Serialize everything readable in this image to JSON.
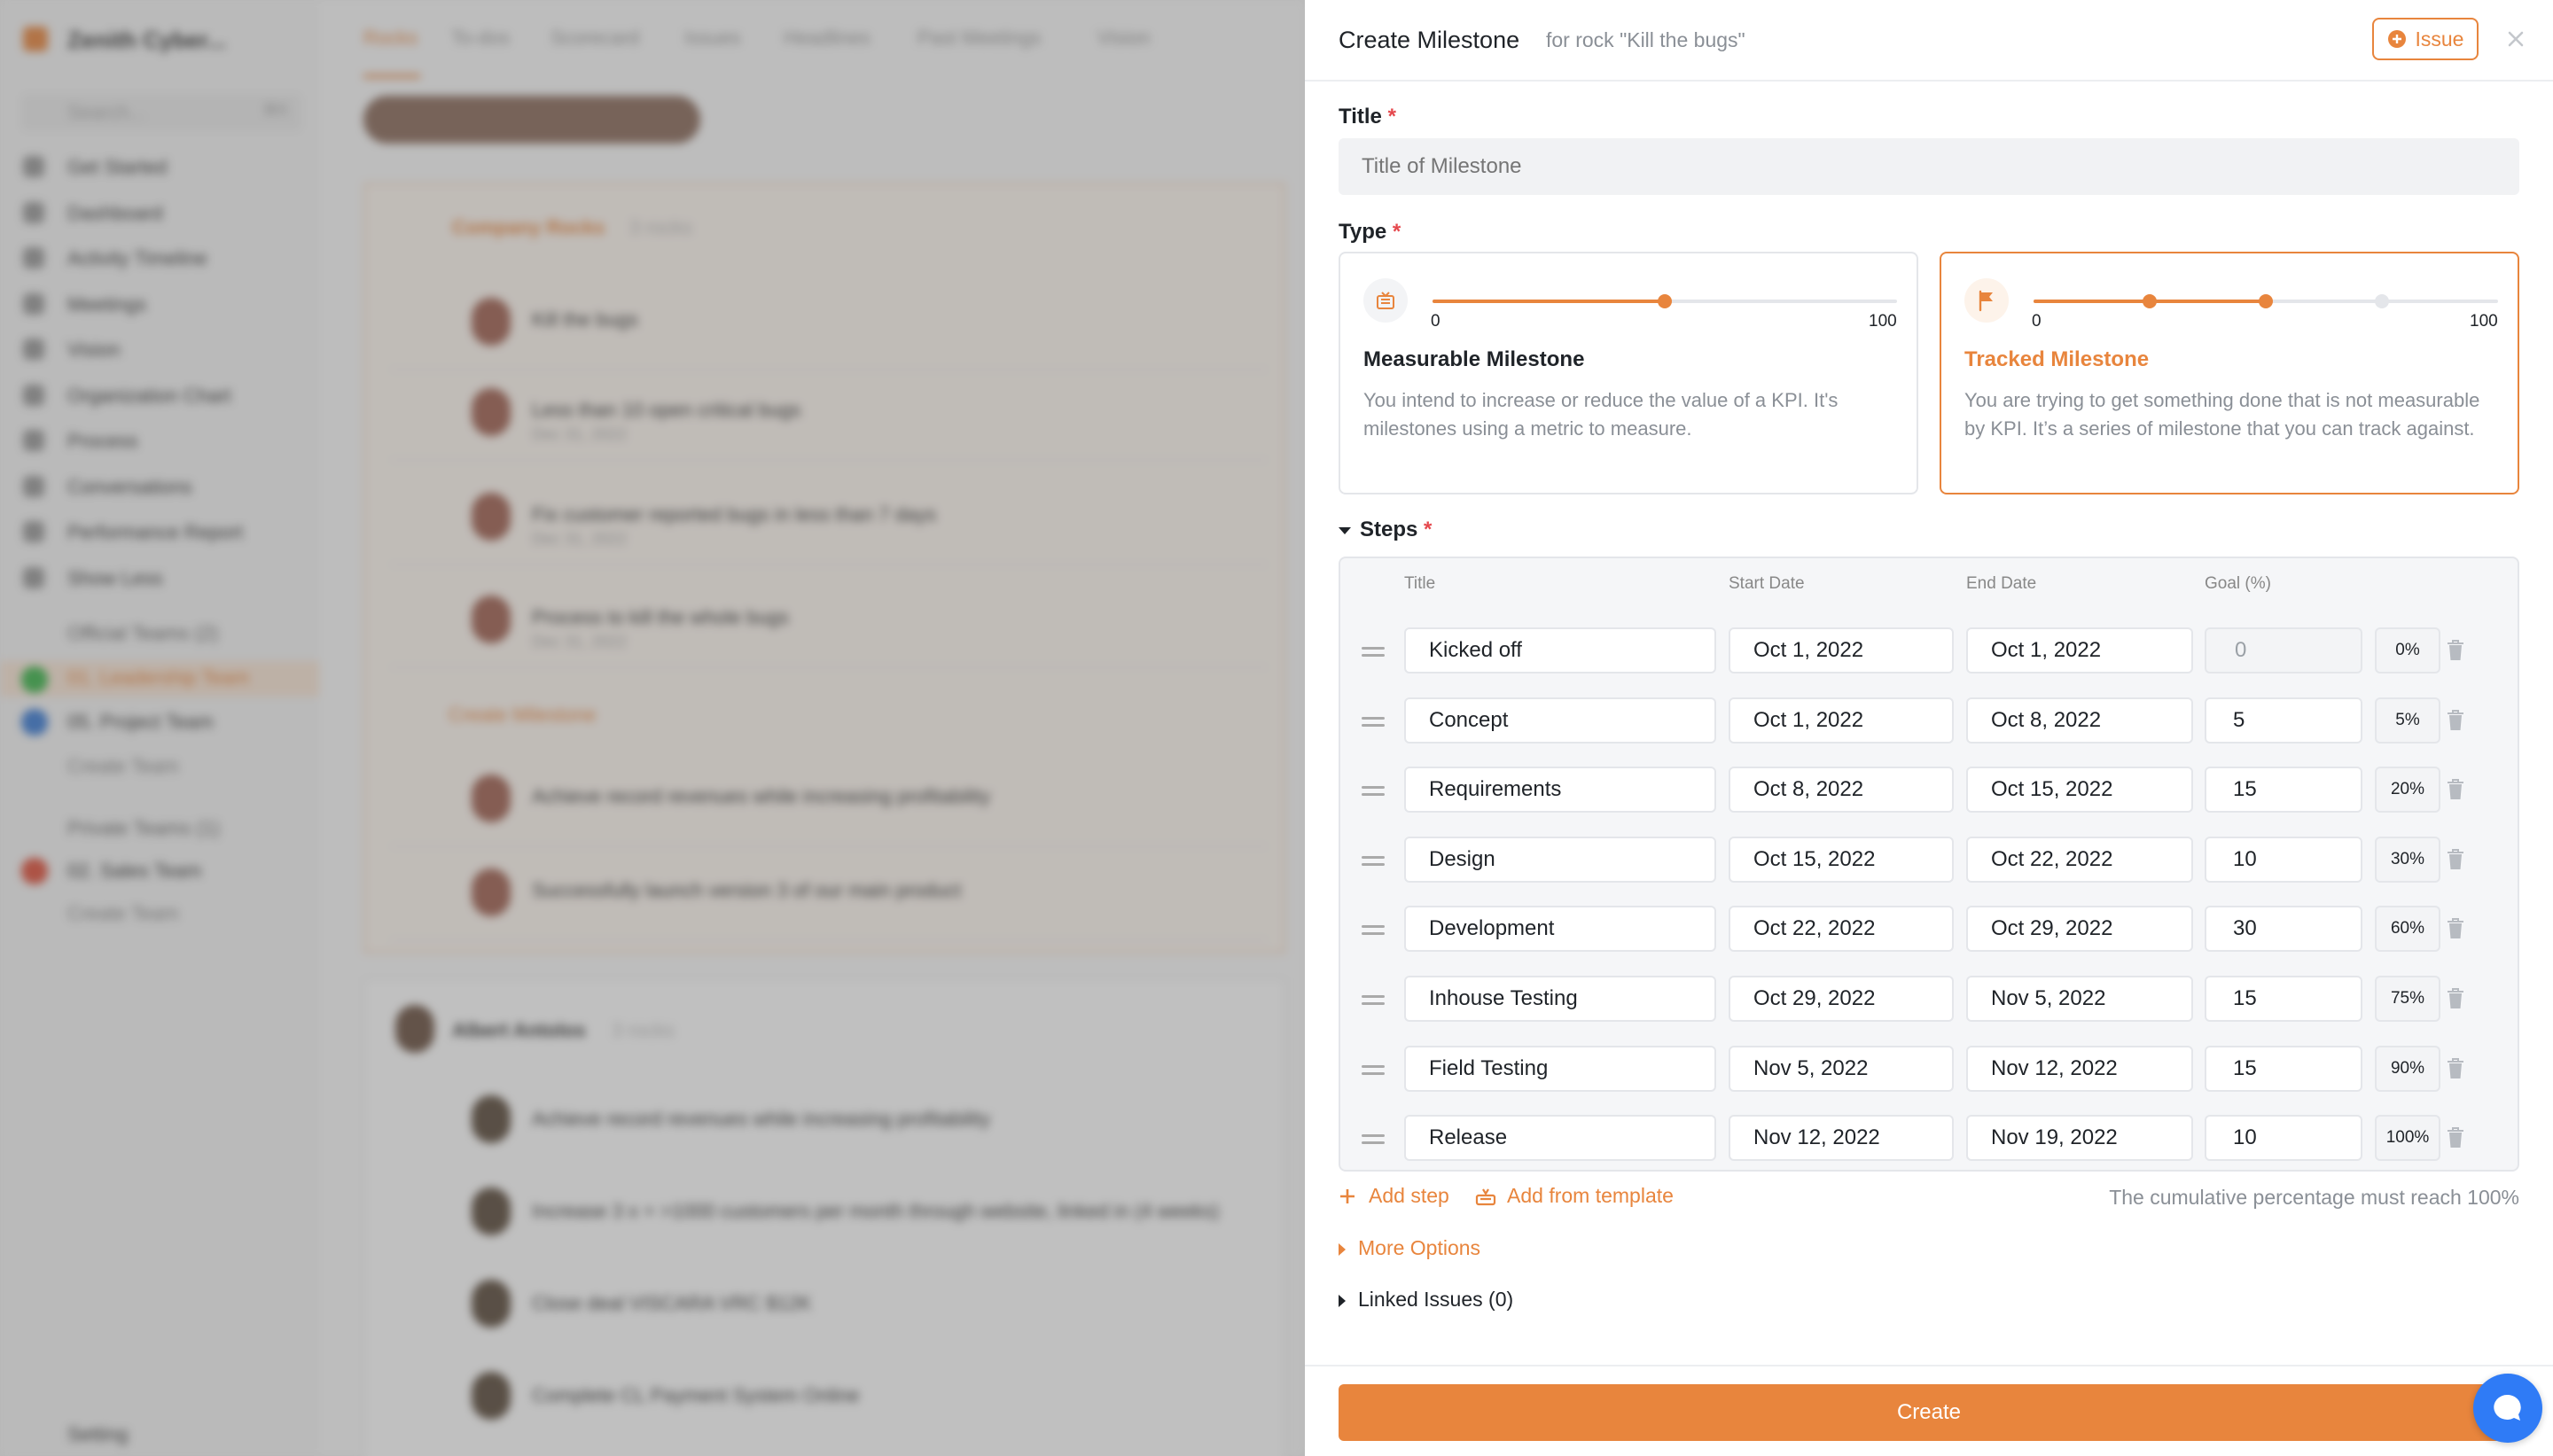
{
  "background": {
    "workspace_name": "Zenith Cyber...",
    "search_placeholder": "Search...",
    "search_shortcut": "⌘K",
    "nav": [
      "Get Started",
      "Dashboard",
      "Activity Timeline",
      "Meetings",
      "Vision",
      "Organization Chart",
      "Process",
      "Conversations",
      "Performance Report",
      "Show Less"
    ],
    "official_teams_label": "Official Teams (2)",
    "official_teams": [
      "01. Leadership Team",
      "05. Project Team",
      "Create Team"
    ],
    "private_teams_label": "Private Teams (1)",
    "private_teams": [
      "02. Sales Team",
      "Create Team"
    ],
    "settings": "Setting",
    "tabs": [
      "Rocks",
      "To-dos",
      "Scorecard",
      "Issues",
      "Headlines",
      "Past Meetings",
      "Vision"
    ],
    "group1_title": "Company Rocks",
    "group1_count": "3 rocks",
    "rocks": [
      "Kill the bugs",
      "Less than 10 open critical bugs",
      "Fix customer reported bugs in less than 7 days",
      "Process to kill the whole bugs",
      "Achieve record revenues while increasing profitability",
      "Successfully launch version 3 of our main product"
    ],
    "rock_dates": [
      "Dec 31, 2022",
      "Dec 31, 2022",
      "Dec 31, 2022"
    ],
    "create_milestone": "Create Milestone",
    "group2_title": "Albert Antolos",
    "group2_count": "3 rocks",
    "rocks2": [
      "Achieve record revenues while increasing profitability",
      "Increase 3 x + >1000 customers per month through website, linked in (4 weeks)",
      "Close deal VISCARA VRC $12K",
      "Complete CL Payment System Online"
    ]
  },
  "drawer": {
    "title": "Create Milestone",
    "subtitle": "for rock \"Kill the bugs\"",
    "issue_button": "Issue",
    "title_label": "Title",
    "required_mark": "*",
    "title_placeholder": "Title of Milestone",
    "type_label": "Type",
    "measurable": {
      "min": "0",
      "max": "100",
      "value": 0.5,
      "name": "Measurable Milestone",
      "desc": "You intend to increase or reduce the value of a KPI. It's milestones using a metric to measure."
    },
    "tracked": {
      "min": "0",
      "max": "100",
      "points": [
        0.25,
        0.5,
        0.75
      ],
      "name": "Tracked Milestone",
      "desc": "You are trying to get something done that is not measurable by KPI. It’s a series of milestone that you can track against."
    },
    "steps_label": "Steps",
    "columns": {
      "title": "Title",
      "start": "Start Date",
      "end": "End Date",
      "goal": "Goal (%)"
    },
    "steps": [
      {
        "title": "Kicked off",
        "start": "Oct 1, 2022",
        "end": "Oct 1, 2022",
        "goal": "0",
        "pct": "0%"
      },
      {
        "title": "Concept",
        "start": "Oct 1, 2022",
        "end": "Oct 8, 2022",
        "goal": "5",
        "pct": "5%"
      },
      {
        "title": "Requirements",
        "start": "Oct 8, 2022",
        "end": "Oct 15, 2022",
        "goal": "15",
        "pct": "20%"
      },
      {
        "title": "Design",
        "start": "Oct 15, 2022",
        "end": "Oct 22, 2022",
        "goal": "10",
        "pct": "30%"
      },
      {
        "title": "Development",
        "start": "Oct 22, 2022",
        "end": "Oct 29, 2022",
        "goal": "30",
        "pct": "60%"
      },
      {
        "title": "Inhouse Testing",
        "start": "Oct 29, 2022",
        "end": "Nov 5, 2022",
        "goal": "15",
        "pct": "75%"
      },
      {
        "title": "Field Testing",
        "start": "Nov 5, 2022",
        "end": "Nov 12, 2022",
        "goal": "15",
        "pct": "90%"
      },
      {
        "title": "Release",
        "start": "Nov 12, 2022",
        "end": "Nov 19, 2022",
        "goal": "10",
        "pct": "100%"
      }
    ],
    "add_step": "Add step",
    "add_template": "Add from template",
    "cumulative_note": "The cumulative percentage must reach 100%",
    "more_options": "More Options",
    "linked_issues": "Linked Issues (0)",
    "create_button": "Create",
    "colors": {
      "accent": "#e8853d",
      "accent_bg": "#fdf3ea",
      "required": "#e5484d",
      "chat": "#2f7bf6"
    }
  }
}
